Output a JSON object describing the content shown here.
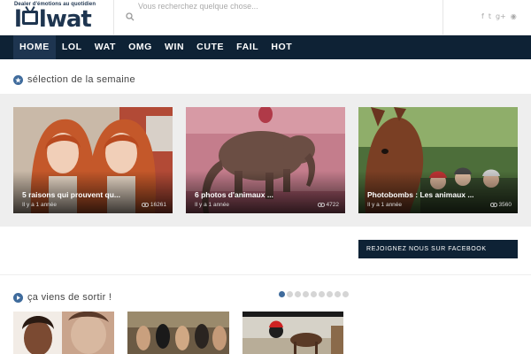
{
  "header": {
    "logo_tagline": "Dealer d'émotions au quotidien",
    "logo_text_left": "l",
    "logo_text_right": "lwat",
    "search_placeholder": "Vous recherchez quelque chose...",
    "social_icons": [
      "facebook-icon",
      "twitter-icon",
      "google-plus-icon",
      "rss-icon"
    ]
  },
  "nav": {
    "items": [
      "HOME",
      "LOL",
      "WAT",
      "OMG",
      "WIN",
      "CUTE",
      "FAIL",
      "HOT"
    ],
    "active": "HOME"
  },
  "featured": {
    "heading": "sélection de la semaine",
    "cards": [
      {
        "title": "5 raisons qui prouvent qu...",
        "date": "Il y a 1 année",
        "views": "16261"
      },
      {
        "title": "6 photos d'animaux ...",
        "date": "Il y a 1 année",
        "views": "4722"
      },
      {
        "title": "Photobombs : Les animaux ...",
        "date": "Il y a 1 année",
        "views": "3560"
      }
    ]
  },
  "sidebar": {
    "facebook_label": "REJOIGNEZ NOUS SUR FACEBOOK"
  },
  "latest": {
    "heading": "ça viens de sortir !",
    "page_count": 9,
    "current_page": 1
  },
  "colors": {
    "brand_navy": "#0e2235",
    "accent_blue": "#3f6b9c",
    "band_gray": "#eeeeee"
  }
}
